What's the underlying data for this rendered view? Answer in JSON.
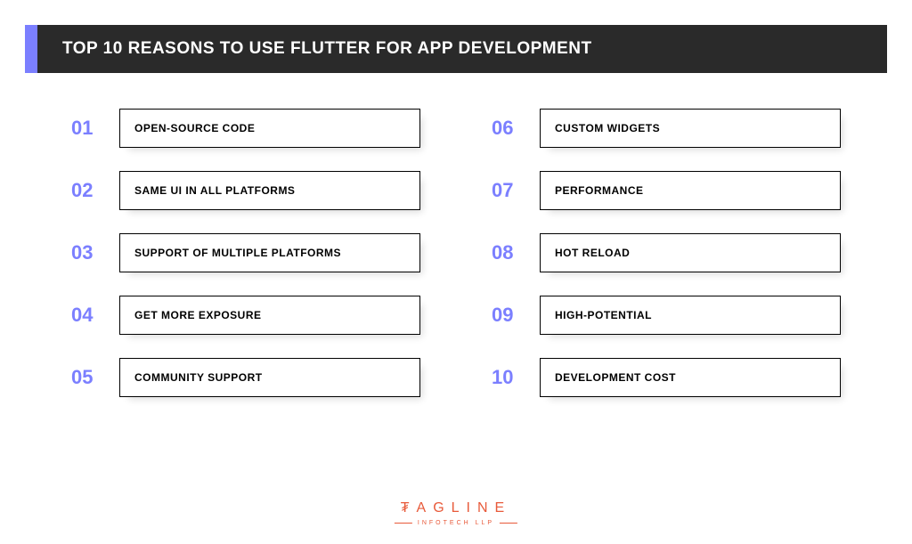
{
  "header": {
    "title": "TOP 10 REASONS TO USE FLUTTER FOR APP DEVELOPMENT"
  },
  "reasons": [
    {
      "num": "01",
      "label": "OPEN-SOURCE CODE"
    },
    {
      "num": "02",
      "label": "SAME UI IN ALL PLATFORMS"
    },
    {
      "num": "03",
      "label": "SUPPORT OF MULTIPLE PLATFORMS"
    },
    {
      "num": "04",
      "label": "GET MORE EXPOSURE"
    },
    {
      "num": "05",
      "label": "COMMUNITY SUPPORT"
    },
    {
      "num": "06",
      "label": "CUSTOM WIDGETS"
    },
    {
      "num": "07",
      "label": "PERFORMANCE"
    },
    {
      "num": "08",
      "label": "HOT RELOAD"
    },
    {
      "num": "09",
      "label": "HIGH-POTENTIAL"
    },
    {
      "num": "10",
      "label": "DEVELOPMENT COST"
    }
  ],
  "logo": {
    "name": "₮AGLINE",
    "sub": "INFOTECH LLP"
  }
}
